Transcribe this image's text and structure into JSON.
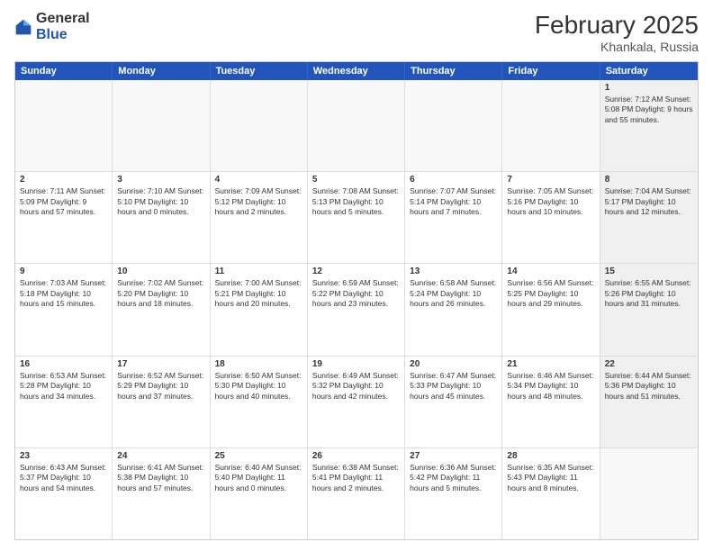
{
  "header": {
    "logo": {
      "line1": "General",
      "line2": "Blue"
    },
    "title": "February 2025",
    "location": "Khankala, Russia"
  },
  "weekdays": [
    "Sunday",
    "Monday",
    "Tuesday",
    "Wednesday",
    "Thursday",
    "Friday",
    "Saturday"
  ],
  "weeks": [
    [
      {
        "day": "",
        "info": "",
        "empty": true
      },
      {
        "day": "",
        "info": "",
        "empty": true
      },
      {
        "day": "",
        "info": "",
        "empty": true
      },
      {
        "day": "",
        "info": "",
        "empty": true
      },
      {
        "day": "",
        "info": "",
        "empty": true
      },
      {
        "day": "",
        "info": "",
        "empty": true
      },
      {
        "day": "1",
        "info": "Sunrise: 7:12 AM\nSunset: 5:08 PM\nDaylight: 9 hours and 55 minutes.",
        "shaded": true
      }
    ],
    [
      {
        "day": "2",
        "info": "Sunrise: 7:11 AM\nSunset: 5:09 PM\nDaylight: 9 hours and 57 minutes."
      },
      {
        "day": "3",
        "info": "Sunrise: 7:10 AM\nSunset: 5:10 PM\nDaylight: 10 hours and 0 minutes."
      },
      {
        "day": "4",
        "info": "Sunrise: 7:09 AM\nSunset: 5:12 PM\nDaylight: 10 hours and 2 minutes."
      },
      {
        "day": "5",
        "info": "Sunrise: 7:08 AM\nSunset: 5:13 PM\nDaylight: 10 hours and 5 minutes."
      },
      {
        "day": "6",
        "info": "Sunrise: 7:07 AM\nSunset: 5:14 PM\nDaylight: 10 hours and 7 minutes."
      },
      {
        "day": "7",
        "info": "Sunrise: 7:05 AM\nSunset: 5:16 PM\nDaylight: 10 hours and 10 minutes."
      },
      {
        "day": "8",
        "info": "Sunrise: 7:04 AM\nSunset: 5:17 PM\nDaylight: 10 hours and 12 minutes.",
        "shaded": true
      }
    ],
    [
      {
        "day": "9",
        "info": "Sunrise: 7:03 AM\nSunset: 5:18 PM\nDaylight: 10 hours and 15 minutes."
      },
      {
        "day": "10",
        "info": "Sunrise: 7:02 AM\nSunset: 5:20 PM\nDaylight: 10 hours and 18 minutes."
      },
      {
        "day": "11",
        "info": "Sunrise: 7:00 AM\nSunset: 5:21 PM\nDaylight: 10 hours and 20 minutes."
      },
      {
        "day": "12",
        "info": "Sunrise: 6:59 AM\nSunset: 5:22 PM\nDaylight: 10 hours and 23 minutes."
      },
      {
        "day": "13",
        "info": "Sunrise: 6:58 AM\nSunset: 5:24 PM\nDaylight: 10 hours and 26 minutes."
      },
      {
        "day": "14",
        "info": "Sunrise: 6:56 AM\nSunset: 5:25 PM\nDaylight: 10 hours and 29 minutes."
      },
      {
        "day": "15",
        "info": "Sunrise: 6:55 AM\nSunset: 5:26 PM\nDaylight: 10 hours and 31 minutes.",
        "shaded": true
      }
    ],
    [
      {
        "day": "16",
        "info": "Sunrise: 6:53 AM\nSunset: 5:28 PM\nDaylight: 10 hours and 34 minutes."
      },
      {
        "day": "17",
        "info": "Sunrise: 6:52 AM\nSunset: 5:29 PM\nDaylight: 10 hours and 37 minutes."
      },
      {
        "day": "18",
        "info": "Sunrise: 6:50 AM\nSunset: 5:30 PM\nDaylight: 10 hours and 40 minutes."
      },
      {
        "day": "19",
        "info": "Sunrise: 6:49 AM\nSunset: 5:32 PM\nDaylight: 10 hours and 42 minutes."
      },
      {
        "day": "20",
        "info": "Sunrise: 6:47 AM\nSunset: 5:33 PM\nDaylight: 10 hours and 45 minutes."
      },
      {
        "day": "21",
        "info": "Sunrise: 6:46 AM\nSunset: 5:34 PM\nDaylight: 10 hours and 48 minutes."
      },
      {
        "day": "22",
        "info": "Sunrise: 6:44 AM\nSunset: 5:36 PM\nDaylight: 10 hours and 51 minutes.",
        "shaded": true
      }
    ],
    [
      {
        "day": "23",
        "info": "Sunrise: 6:43 AM\nSunset: 5:37 PM\nDaylight: 10 hours and 54 minutes."
      },
      {
        "day": "24",
        "info": "Sunrise: 6:41 AM\nSunset: 5:38 PM\nDaylight: 10 hours and 57 minutes."
      },
      {
        "day": "25",
        "info": "Sunrise: 6:40 AM\nSunset: 5:40 PM\nDaylight: 11 hours and 0 minutes."
      },
      {
        "day": "26",
        "info": "Sunrise: 6:38 AM\nSunset: 5:41 PM\nDaylight: 11 hours and 2 minutes."
      },
      {
        "day": "27",
        "info": "Sunrise: 6:36 AM\nSunset: 5:42 PM\nDaylight: 11 hours and 5 minutes."
      },
      {
        "day": "28",
        "info": "Sunrise: 6:35 AM\nSunset: 5:43 PM\nDaylight: 11 hours and 8 minutes."
      },
      {
        "day": "",
        "info": "",
        "empty": true
      }
    ]
  ]
}
